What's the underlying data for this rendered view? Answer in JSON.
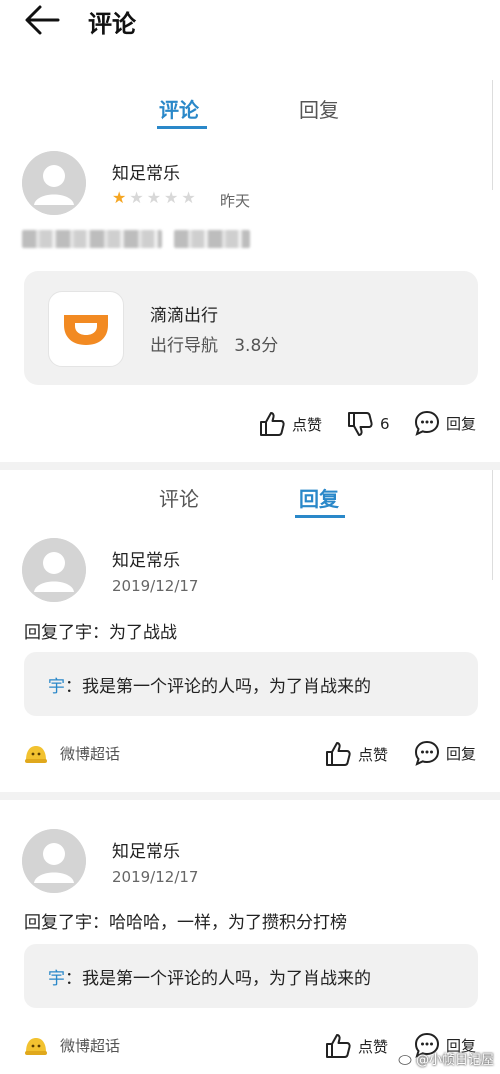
{
  "header": {
    "title": "评论"
  },
  "tabs_top": {
    "comment": "评论",
    "reply": "回复",
    "active": "comment"
  },
  "review": {
    "username": "知足常乐",
    "rating": 1,
    "max_rating": 5,
    "time": "昨天",
    "app": {
      "name": "滴滴出行",
      "category": "出行导航",
      "score": "3.8分",
      "category_score": "出行导航   3.8分"
    },
    "actions": {
      "like": "点赞",
      "dislike_count": "6",
      "reply": "回复"
    }
  },
  "tabs_mid": {
    "comment": "评论",
    "reply": "回复",
    "active": "reply"
  },
  "replies": [
    {
      "username": "知足常乐",
      "date": "2019/12/17",
      "text": "回复了宇：为了战战",
      "quote_name": "宇",
      "quote_text": "：我是第一个评论的人吗，为了肖战来的",
      "source": "微博超话",
      "like": "点赞",
      "reply": "回复"
    },
    {
      "username": "知足常乐",
      "date": "2019/12/17",
      "text": "回复了宇：哈哈哈，一样，为了攒积分打榜",
      "quote_name": "宇",
      "quote_text": "：我是第一个评论的人吗，为了肖战来的",
      "source": "微博超话",
      "like": "点赞",
      "reply": "回复"
    }
  ],
  "watermark": "@小帧日记屋",
  "colors": {
    "accent": "#2a88c9",
    "star_filled": "#f5a623",
    "star_empty": "#d8d8d8",
    "didi_orange": "#f28a22"
  }
}
